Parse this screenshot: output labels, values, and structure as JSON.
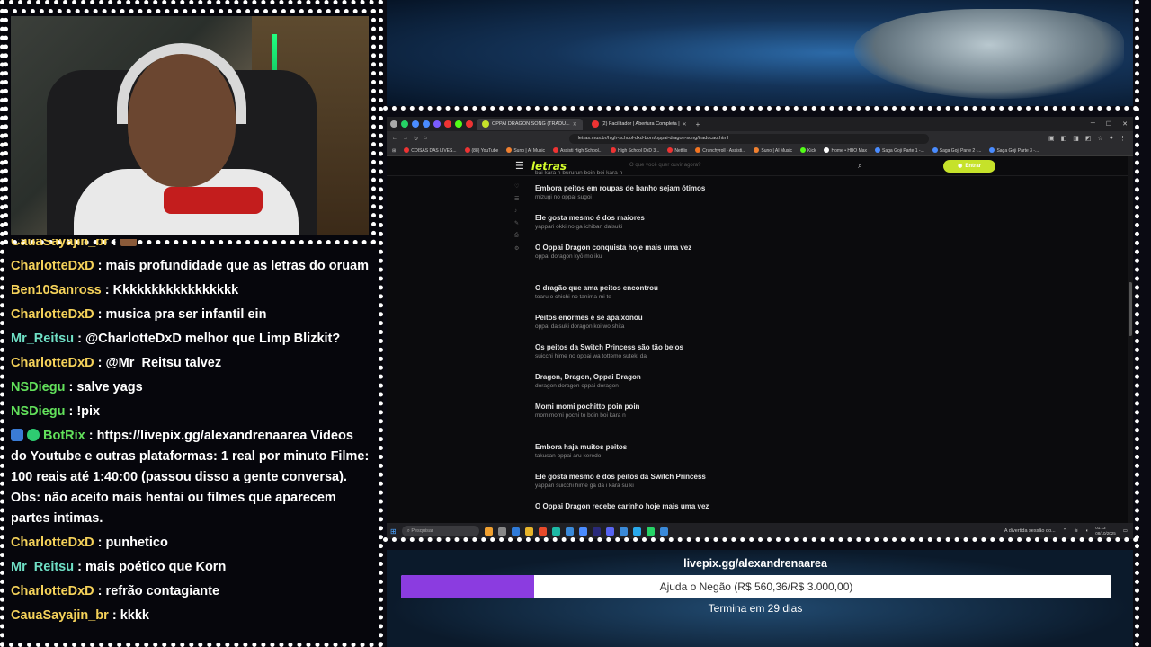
{
  "chat": {
    "messages": [
      {
        "user": "CauaSayajin_br",
        "text": "",
        "color": "#f5d25a",
        "emote": true
      },
      {
        "user": "CharlotteDxD",
        "text": "mais profundidade que as letras do oruam",
        "color": "#f5d25a"
      },
      {
        "user": "Ben10Sanross",
        "text": "Kkkkkkkkkkkkkkkkk",
        "color": "#f5d25a"
      },
      {
        "user": "CharlotteDxD",
        "text": "musica pra ser infantil ein",
        "color": "#f5d25a"
      },
      {
        "user": "Mr_Reitsu",
        "text": "@CharlotteDxD melhor que Limp Blizkit?",
        "color": "#6fe0c6"
      },
      {
        "user": "CharlotteDxD",
        "text": "@Mr_Reitsu talvez",
        "color": "#f5d25a"
      },
      {
        "user": "NSDiegu",
        "text": "salve yags",
        "color": "#62e05b"
      },
      {
        "user": "NSDiegu",
        "text": "!pix",
        "color": "#62e05b"
      },
      {
        "user": "BotRix",
        "text": "https://livepix.gg/alexandrenaarea Vídeos do Youtube e outras plataformas: 1 real por minuto Filme: 100 reais até 1:40:00 (passou disso a gente conversa). Obs: não aceito mais hentai ou filmes que aparecem partes intimas.",
        "color": "#62e05b",
        "badges": true
      },
      {
        "user": "CharlotteDxD",
        "text": "punhetico",
        "color": "#f5d25a"
      },
      {
        "user": "Mr_Reitsu",
        "text": "mais poético que Korn",
        "color": "#6fe0c6"
      },
      {
        "user": "CharlotteDxD",
        "text": "refrão contagiante",
        "color": "#f5d25a"
      },
      {
        "user": "CauaSayajin_br",
        "text": "kkkk",
        "color": "#f5d25a"
      }
    ]
  },
  "browser": {
    "tabs": [
      {
        "label": "OPPAI DRAGON SONG (TRADU...",
        "active": true
      },
      {
        "label": "(2) Facilitador | Abertura Completa |",
        "active": false
      }
    ],
    "url": "letras.mus.br/high-school-dxd-born/oppai-dragon-song/traducao.html",
    "bookmarks": [
      "COISAS DAS LIVES...",
      "(88) YouTube",
      "Suno | AI Music",
      "Assisti High School...",
      "High School DxD 3...",
      "Netflix",
      "Crunchyroll - Assisti...",
      "Suno | AI Music",
      "Kick",
      "Home • HBO Max",
      "Saga Goji Parte 1 -...",
      "Saga Goji Parte 2 -...",
      "Saga Goji Parte 3 -..."
    ]
  },
  "site": {
    "logo": "letras",
    "search_placeholder": "O que você quer ouvir agora?",
    "login_label": "Entrar",
    "top_partial": "bai kara n bururun boin boi kara n"
  },
  "lyrics": [
    {
      "pt": "Embora peitos em roupas de banho sejam ótimos",
      "jp": "mizugi no oppai sugoi"
    },
    {
      "pt": "Ele gosta mesmo é dos maiores",
      "jp": "yappari okki no ga ichiban daisuki"
    },
    {
      "pt": "O Oppai Dragon conquista hoje mais uma vez",
      "jp": "oppai doragon kyō mo iku",
      "gap_after": true
    },
    {
      "pt": "O dragão que ama peitos encontrou",
      "jp": "toaru o chichi no tanima mi te"
    },
    {
      "pt": "Peitos enormes e se apaixonou",
      "jp": "oppai daisuki doragon koi wo shita"
    },
    {
      "pt": "Os peitos da Switch Princess são tão belos",
      "jp": "suicchi hime no oppai wa tottemo suteki da"
    },
    {
      "pt": "Dragon, Dragon, Oppai Dragon",
      "jp": "doragon doragon oppai doragon"
    },
    {
      "pt": "Momi momi pochitto poin poin",
      "jp": "momimomi pochi to boin boi kara n",
      "gap_after": true
    },
    {
      "pt": "Embora haja muitos peitos",
      "jp": "takusan oppai aru keredo"
    },
    {
      "pt": "Ele gosta mesmo é dos peitos da Switch Princess",
      "jp": "yappari suicchi hime ga da i kara su ki"
    },
    {
      "pt": "O Oppai Dragon recebe carinho hoje mais uma vez",
      "jp": ""
    }
  ],
  "taskbar": {
    "search": "Pesquisar",
    "notification": "A divertida sessão do...",
    "time": "01:13",
    "date": "08/10/2025"
  },
  "donation": {
    "url": "livepix.gg/alexandrenaarea",
    "text": "Ajuda o Negão (R$ 560,36/R$ 3.000,00)",
    "progress": 0.1868,
    "remaining": "Termina em 29 dias",
    "fill_color": "#8b3ce0"
  }
}
